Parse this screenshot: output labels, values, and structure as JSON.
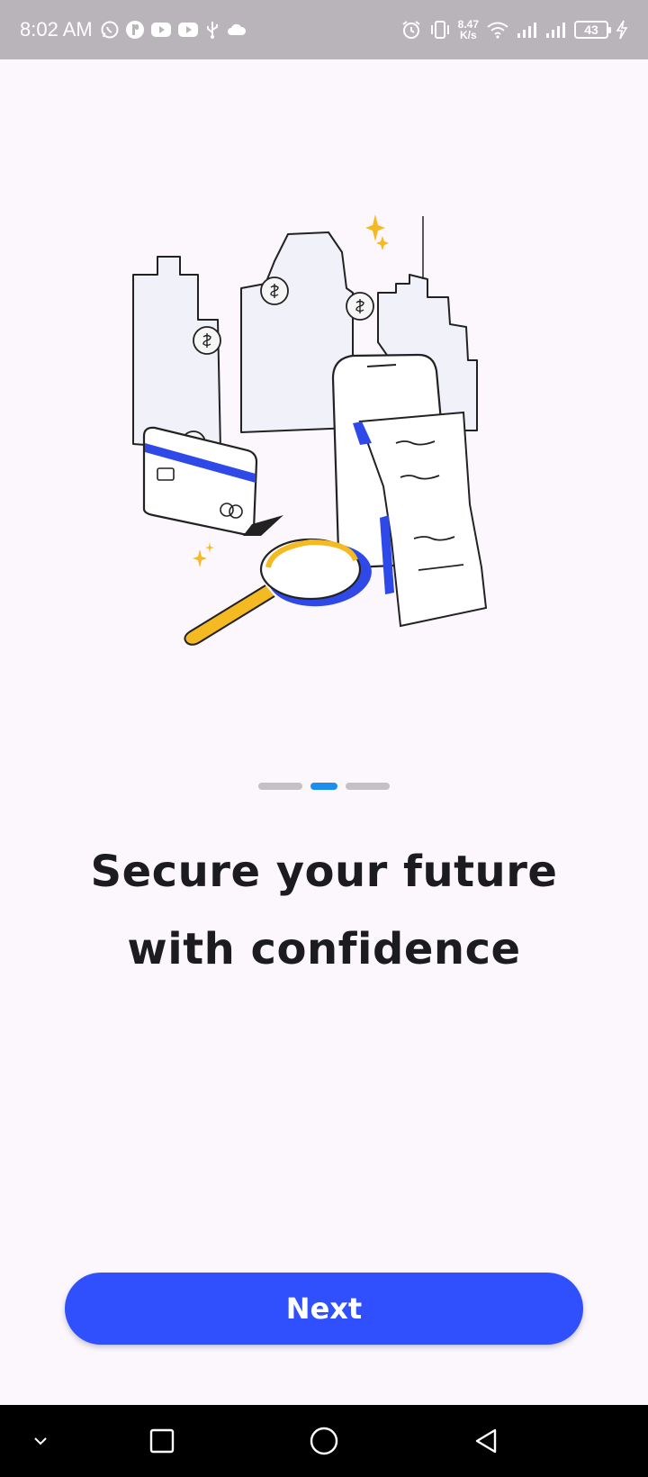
{
  "status_bar": {
    "time": "8:02 AM",
    "net_speed_value": "8.47",
    "net_speed_unit": "K/s",
    "battery_level": "43",
    "left_icons": [
      "whatsapp-icon",
      "app-notification-icon",
      "youtube-icon",
      "youtube-icon",
      "usb-icon",
      "cloud-icon"
    ],
    "right_icons": [
      "alarm-icon",
      "vibrate-icon",
      "wifi-icon",
      "signal-icon",
      "signal-icon",
      "battery-icon",
      "charging-icon"
    ]
  },
  "onboarding": {
    "illustration": "finance-city-illustration",
    "page_count": 3,
    "active_page": 2,
    "headline_line1": "Secure your future",
    "headline_line2": "with confidence",
    "next_label": "Next"
  },
  "nav_bar": {
    "icons": [
      "chevron-down-icon",
      "recents-square-icon",
      "home-circle-icon",
      "back-triangle-icon"
    ]
  },
  "colors": {
    "accent": "#3050fd",
    "pager_active": "#1c8ef0",
    "pager_inactive": "#c4c0c4",
    "background": "#fcf7fc",
    "status_bar": "#b8b4b9",
    "illustration_blue": "#2f49e8",
    "illustration_yellow": "#f5b921"
  }
}
